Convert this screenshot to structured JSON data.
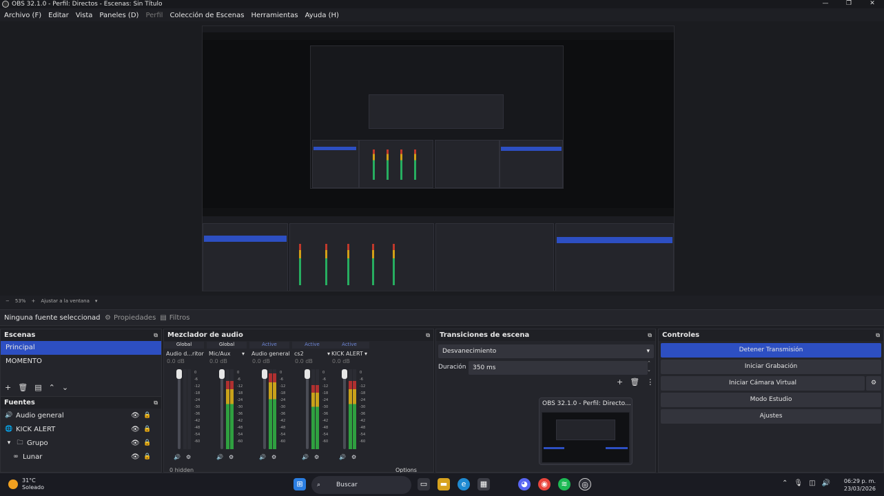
{
  "window": {
    "title": "OBS 32.1.0 - Perfil: Directos - Escenas: Sin Título"
  },
  "menu": [
    "Archivo (F)",
    "Editar",
    "Vista",
    "Paneles (D)",
    "Perfil",
    "Colección de Escenas",
    "Herramientas",
    "Ayuda (H)"
  ],
  "zoom": {
    "value": "53%",
    "fit_label": "Ajustar a la ventana"
  },
  "source_toolbar": {
    "no_source": "Ninguna fuente seleccionada",
    "properties": "Propiedades",
    "filters": "Filtros"
  },
  "scenes": {
    "title": "Escenas",
    "items": [
      "Principal",
      "MOMENTO"
    ],
    "selected": 0
  },
  "sources": {
    "title": "Fuentes",
    "items": [
      {
        "label": "Audio general",
        "icon": "speaker-icon"
      },
      {
        "label": "KICK ALERT",
        "icon": "globe-icon"
      },
      {
        "label": "Grupo",
        "icon": "folder-icon"
      },
      {
        "label": "Lunar",
        "icon": "link-icon"
      }
    ]
  },
  "mixer": {
    "title": "Mezclador de audio",
    "channels": [
      {
        "status": "Global",
        "name": "Audio d...ritorio",
        "db": "0.0 dB",
        "level": 0.0
      },
      {
        "status": "Global",
        "name": "Mic/Aux",
        "db": "0.0 dB",
        "level": 0.85
      },
      {
        "status": "Active",
        "name": "Audio general",
        "db": "0.0 dB",
        "level": 0.95
      },
      {
        "status": "Active",
        "name": "cs2",
        "db": "0.0 dB",
        "level": 0.8
      },
      {
        "status": "Active",
        "name": "KICK ALERT",
        "db": "0.0 dB",
        "level": 0.85
      }
    ],
    "scale": [
      "0",
      "-6",
      "-12",
      "-18",
      "-24",
      "-30",
      "-36",
      "-42",
      "-48",
      "-54",
      "-60"
    ],
    "hidden_label": "0 hidden",
    "options_label": "Options"
  },
  "transitions": {
    "title": "Transiciones de escena",
    "selected": "Desvanecimiento",
    "duration_label": "Duración",
    "duration_value": "350 ms"
  },
  "controls": {
    "title": "Controles",
    "buttons": [
      "Detener Transmisión",
      "Iniciar Grabación",
      "Iniciar Cámara Virtual",
      "Modo Estudio",
      "Ajustes"
    ]
  },
  "thumbnail": {
    "title": "OBS 32.1.0 - Perfil: Directo..."
  },
  "taskbar": {
    "temp": "31°C",
    "weather": "Soleado",
    "search": "Buscar",
    "time": "06:29 p. m.",
    "date": "23/03/2026"
  },
  "colors": {
    "accent": "#2d4fc2",
    "panel": "#24252b",
    "bg": "#1e1f24"
  }
}
